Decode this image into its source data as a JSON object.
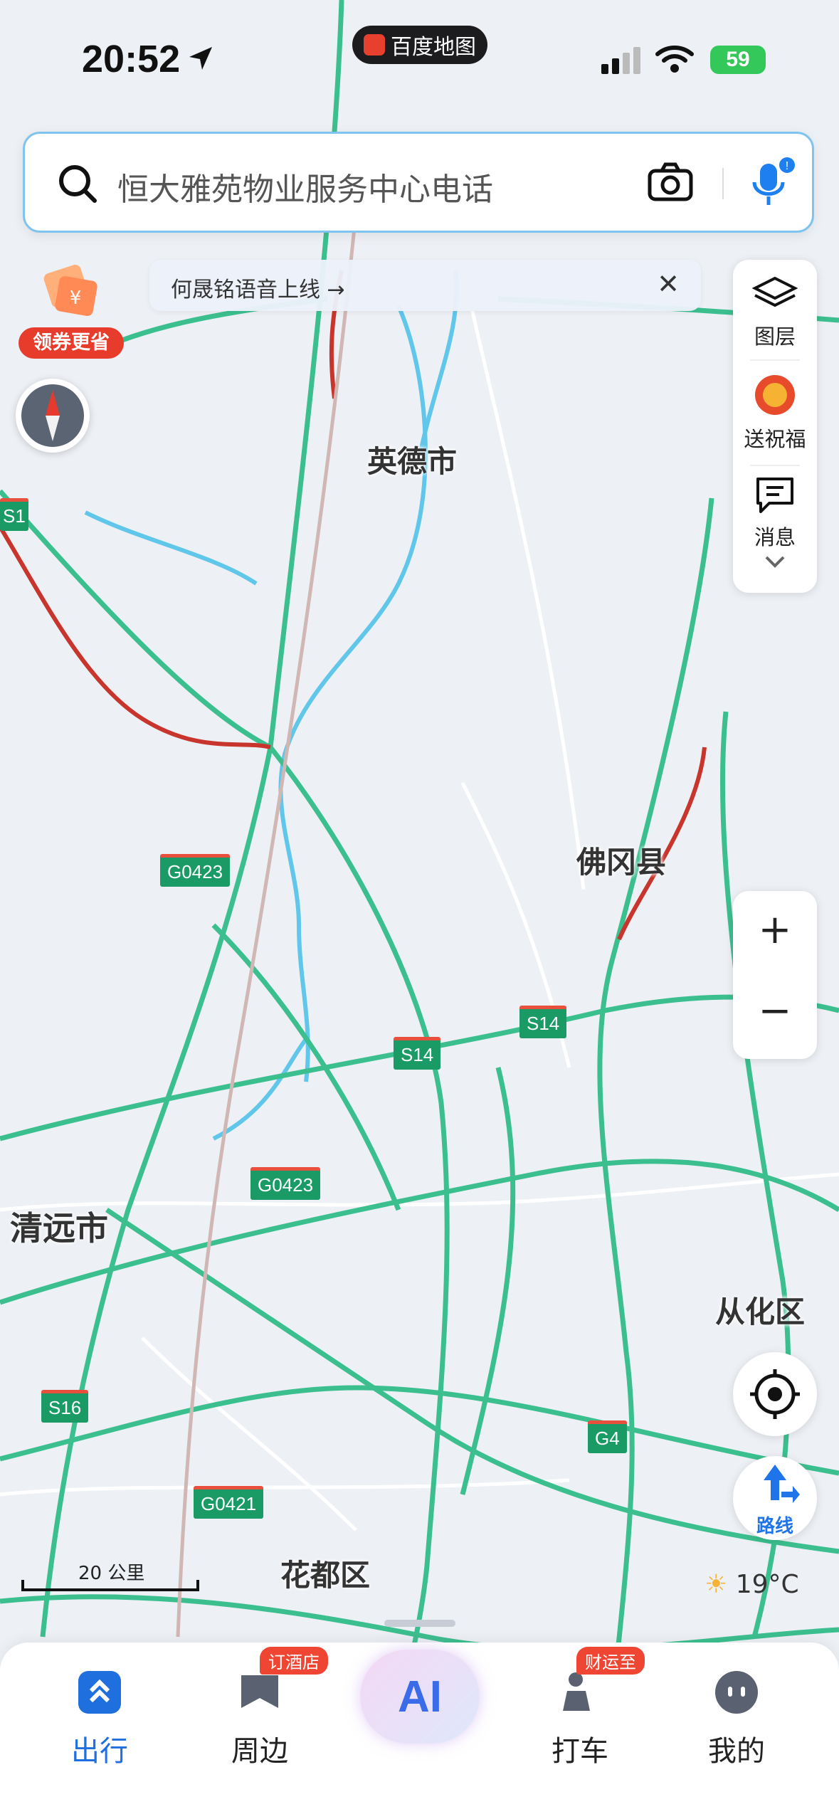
{
  "status_bar": {
    "time": "20:52",
    "app_name": "百度地图",
    "battery": "59"
  },
  "search": {
    "placeholder": "恒大雅苑物业服务中心电话"
  },
  "coupon": {
    "label": "领券更省"
  },
  "notice": {
    "text": "何晟铭语音上线 →",
    "close": "✕"
  },
  "right_panel": {
    "layers": "图层",
    "blessing": "送祝福",
    "messages": "消息"
  },
  "map": {
    "cities": [
      "英德市",
      "佛冈县",
      "清远市",
      "从化区",
      "花都区"
    ],
    "shields": [
      "G0423",
      "S14",
      "S14",
      "G0423",
      "S16",
      "G4",
      "G0421",
      "S1"
    ]
  },
  "zoom": {
    "in": "+",
    "out": "−"
  },
  "route": {
    "label": "路线"
  },
  "scale": {
    "label": "20 公里"
  },
  "weather": {
    "temp": "19°C"
  },
  "tabs": [
    {
      "label": "出行"
    },
    {
      "label": "周边",
      "tag": "订酒店"
    },
    {
      "label": "AI"
    },
    {
      "label": "打车",
      "tag": "财运至"
    },
    {
      "label": "我的"
    }
  ],
  "colors": {
    "accent": "#1f6fde",
    "road_green": "#3cbf8f",
    "road_red": "#c8352c",
    "water": "#5fc4ea"
  }
}
